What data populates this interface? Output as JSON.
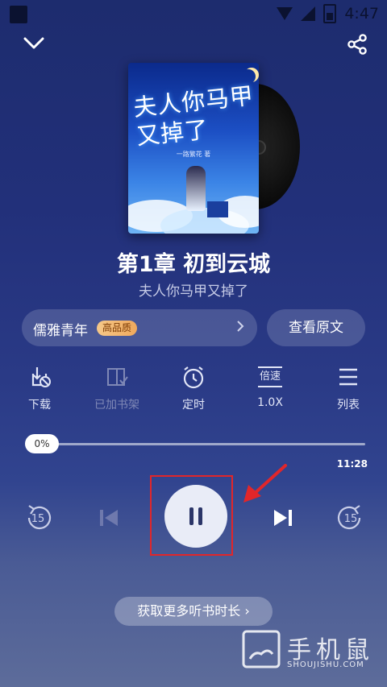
{
  "status_bar": {
    "time": "4:47"
  },
  "icons": {
    "collapse": "chevron-down-icon",
    "share": "share-icon"
  },
  "cover": {
    "title": "夫人你马甲又掉了",
    "author_line": "一路繁花 著"
  },
  "chapter": {
    "title": "第1章 初到云城",
    "book_name": "夫人你马甲又掉了"
  },
  "voice": {
    "name": "儒雅青年",
    "badge": "高品质"
  },
  "view_original_label": "查看原文",
  "tools": [
    {
      "label": "下载",
      "icon": "download-icon"
    },
    {
      "label": "已加书架",
      "icon": "bookshelf-icon"
    },
    {
      "label": "定时",
      "icon": "timer-icon"
    },
    {
      "label": "1.0X",
      "icon": "speed-icon",
      "icon_text": "倍速"
    },
    {
      "label": "列表",
      "icon": "list-icon"
    }
  ],
  "progress": {
    "current_label": "0%",
    "fraction": 0,
    "duration": "11:28"
  },
  "controls": {
    "rewind_seconds": "15",
    "forward_seconds": "15",
    "state": "playing"
  },
  "more_time_label": "获取更多听书时长",
  "watermark": {
    "name": "手机鼠",
    "site": "SHOUJISHU.COM"
  },
  "colors": {
    "highlight_box": "#e1262a",
    "badge": "#f0a95c",
    "arrow": "#e1262a"
  }
}
